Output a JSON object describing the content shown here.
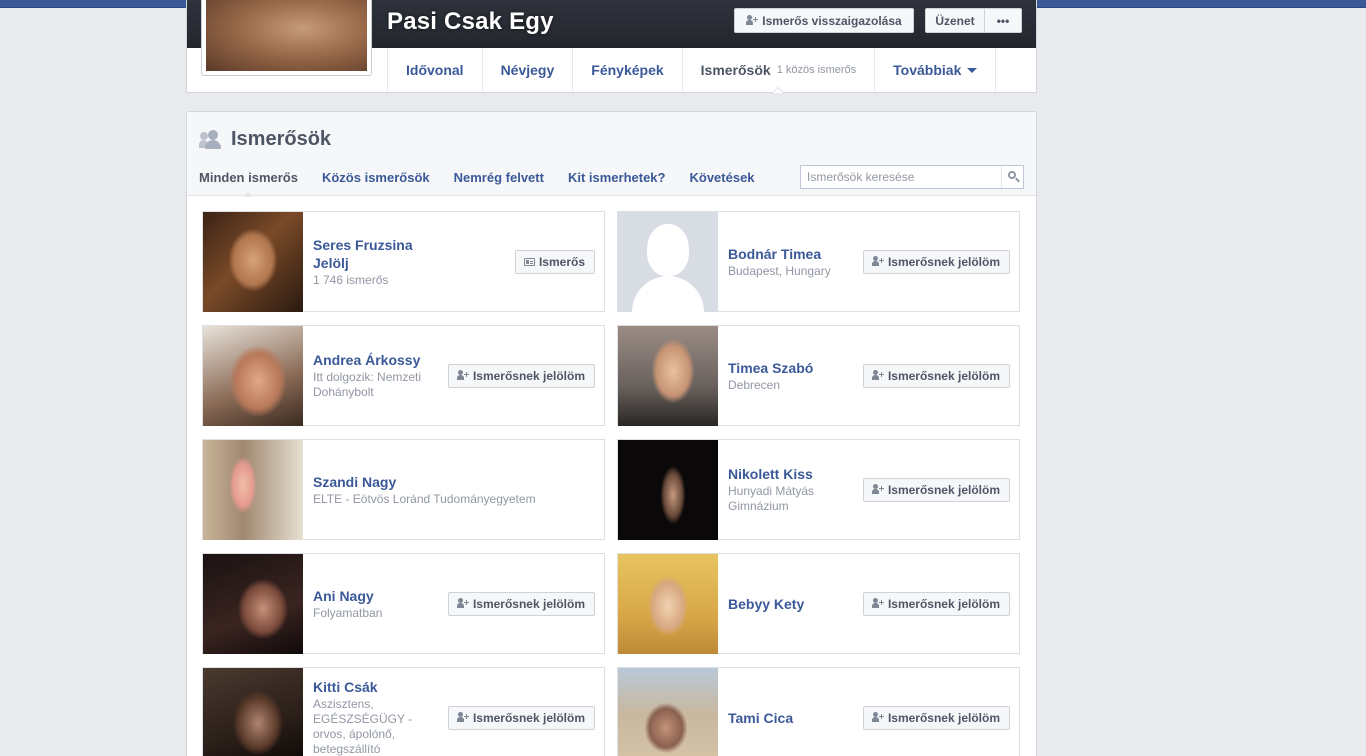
{
  "profile": {
    "name": "Pasi Csak Egy",
    "confirm_button": "Ismerős visszaigazolása",
    "message_button": "Üzenet",
    "more_button": "•••"
  },
  "tabs": [
    {
      "label": "Idővonal"
    },
    {
      "label": "Névjegy"
    },
    {
      "label": "Fényképek"
    },
    {
      "label": "Ismerősök",
      "sub": "1 közös ismerős"
    },
    {
      "label": "Továbbiak"
    }
  ],
  "friends": {
    "title": "Ismerősök",
    "subtabs": [
      "Minden ismerős",
      "Közös ismerősök",
      "Nemrég felvett",
      "Kit ismerhetek?",
      "Követések"
    ],
    "search_placeholder": "Ismerősök keresése",
    "items": [
      {
        "name": "Seres Fruzsina Jelölj",
        "sub": "1 746 ismerős",
        "button": "Ismerős"
      },
      {
        "name": "Bodnár Timea",
        "sub": "Budapest, Hungary",
        "button": "Ismerősnek jelölöm"
      },
      {
        "name": "Andrea Árkossy",
        "sub": "Itt dolgozik: Nemzeti Dohánybolt",
        "button": "Ismerősnek jelölöm"
      },
      {
        "name": "Timea Szabó",
        "sub": "Debrecen",
        "button": "Ismerősnek jelölöm"
      },
      {
        "name": "Szandi Nagy",
        "sub": "ELTE - Eötvös Loránd Tudományegyetem",
        "button": ""
      },
      {
        "name": "Nikolett Kiss",
        "sub": "Hunyadi Mátyás Gimnázium",
        "button": "Ismerősnek jelölöm"
      },
      {
        "name": "Ani Nagy",
        "sub": "Folyamatban",
        "button": "Ismerősnek jelölöm"
      },
      {
        "name": "Bebyy Kety",
        "sub": "",
        "button": "Ismerősnek jelölöm"
      },
      {
        "name": "Kitti Csák",
        "sub": "Aszisztens, EGÉSZSÉGÜGY - orvos, ápolónő, betegszállító",
        "button": "Ismerősnek jelölöm"
      },
      {
        "name": "Tami Cica",
        "sub": "",
        "button": "Ismerősnek jelölöm"
      }
    ]
  },
  "colors": {
    "topbar": "#3b5998",
    "link": "#3b5998",
    "muted": "#9197a3",
    "background": "#e9eaed"
  },
  "icons": [
    "add-friend-icon",
    "friend-card-icon",
    "friends-icon",
    "search-icon",
    "caret-down-icon"
  ]
}
